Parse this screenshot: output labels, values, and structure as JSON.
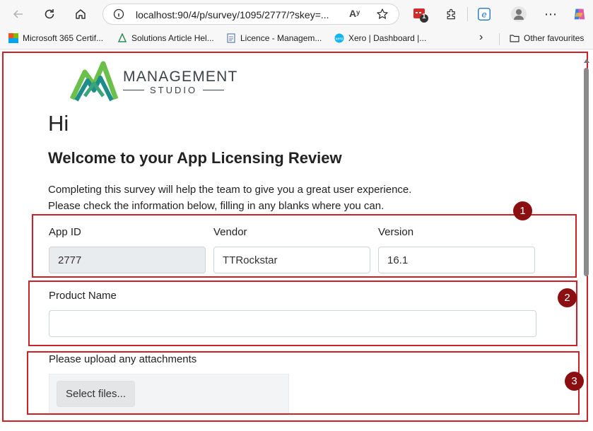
{
  "browser": {
    "url": "localhost:90/4/p/survey/1095/2777/?skey=...",
    "read_aloud": "Aʸ",
    "ext_badge": "1",
    "bookmarks": [
      {
        "label": "Microsoft 365 Certif..."
      },
      {
        "label": "Solutions Article Hel..."
      },
      {
        "label": "Licence - Managem..."
      },
      {
        "label": "Xero | Dashboard |..."
      }
    ],
    "other_favourites": "Other favourites"
  },
  "colors": {
    "accent": "#d11f27",
    "badge": "#8b0e10",
    "brand_green": "#6cbf4b",
    "brand_teal": "#1e8c8a"
  },
  "logo": {
    "brand": "MANAGEMENT",
    "sub": "STUDIO"
  },
  "page": {
    "greeting": "Hi",
    "heading": "Welcome to your App Licensing Review",
    "intro_line1": "Completing this survey will help the team to give you a great user experience.",
    "intro_line2": "Please check the information below, filling in any blanks where you can."
  },
  "form": {
    "app_id_label": "App ID",
    "app_id_value": "2777",
    "vendor_label": "Vendor",
    "vendor_value": "TTRockstar",
    "version_label": "Version",
    "version_value": "16.1",
    "product_name_label": "Product Name",
    "product_name_value": "",
    "attachments_label": "Please upload any attachments",
    "select_files": "Select files..."
  },
  "annotations": [
    "1",
    "2",
    "3"
  ]
}
